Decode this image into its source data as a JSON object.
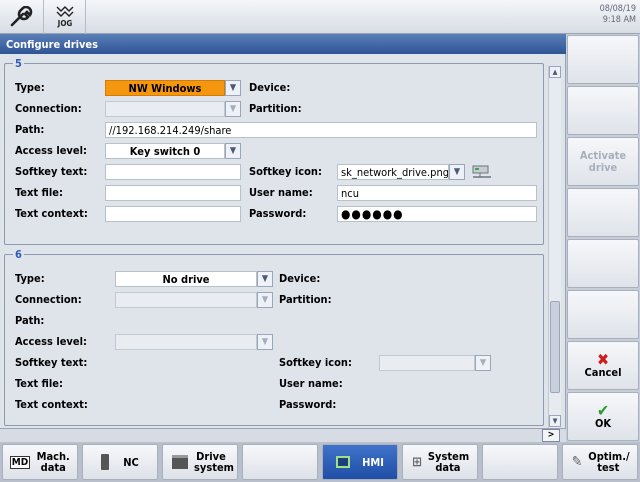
{
  "top": {
    "mode_label": "JOG",
    "date": "08/08/19",
    "time": "9:18 AM"
  },
  "title": "Configure drives",
  "groups": [
    {
      "title": "5",
      "type_label": "Type:",
      "type_value": "NW Windows",
      "device_label": "Device:",
      "connection_label": "Connection:",
      "connection_value": "",
      "partition_label": "Partition:",
      "path_label": "Path:",
      "path_value": "//192.168.214.249/share",
      "access_label": "Access level:",
      "access_value": "Key switch 0",
      "softkey_text_label": "Softkey text:",
      "softkey_text_value": "",
      "softkey_icon_label": "Softkey icon:",
      "softkey_icon_value": "sk_network_drive.png",
      "text_file_label": "Text file:",
      "text_file_value": "",
      "user_label": "User name:",
      "user_value": "ncu",
      "text_context_label": "Text context:",
      "text_context_value": "",
      "password_label": "Password:",
      "password_value": "●●●●●●"
    },
    {
      "title": "6",
      "type_label": "Type:",
      "type_value": "No drive",
      "device_label": "Device:",
      "connection_label": "Connection:",
      "connection_value": "",
      "partition_label": "Partition:",
      "path_label": "Path:",
      "access_label": "Access level:",
      "access_value": "",
      "softkey_text_label": "Softkey text:",
      "softkey_icon_label": "Softkey icon:",
      "softkey_icon_value": "",
      "text_file_label": "Text file:",
      "user_label": "User name:",
      "text_context_label": "Text context:",
      "password_label": "Password:"
    }
  ],
  "status": {
    "next_label": ">"
  },
  "vsoftkeys": [
    {
      "label": "",
      "enabled": true
    },
    {
      "label": "",
      "enabled": true
    },
    {
      "label": "Activate drive",
      "enabled": false
    },
    {
      "label": "",
      "enabled": true
    },
    {
      "label": "",
      "enabled": true
    },
    {
      "label": "",
      "enabled": true
    },
    {
      "label": "Cancel",
      "enabled": true,
      "icon": "cancel-icon"
    },
    {
      "label": "OK",
      "enabled": true,
      "icon": "ok-icon"
    }
  ],
  "hsoftkeys": [
    {
      "label": "Mach. data",
      "icon": "md-icon"
    },
    {
      "label": "NC",
      "icon": "nc-icon"
    },
    {
      "label": "Drive system",
      "icon": "drive-icon"
    },
    {
      "label": "",
      "icon": ""
    },
    {
      "label": "HMI",
      "icon": "hmi-icon",
      "active": true
    },
    {
      "label": "System data",
      "icon": "system-data-icon"
    },
    {
      "label": "",
      "icon": ""
    },
    {
      "label": "Optim./ test",
      "icon": "optim-icon"
    }
  ],
  "colors": {
    "highlight": "#f5960f",
    "title_bar": "#2f5495",
    "group_title": "#2f5db8",
    "active_softkey": "#1f4ea6"
  }
}
